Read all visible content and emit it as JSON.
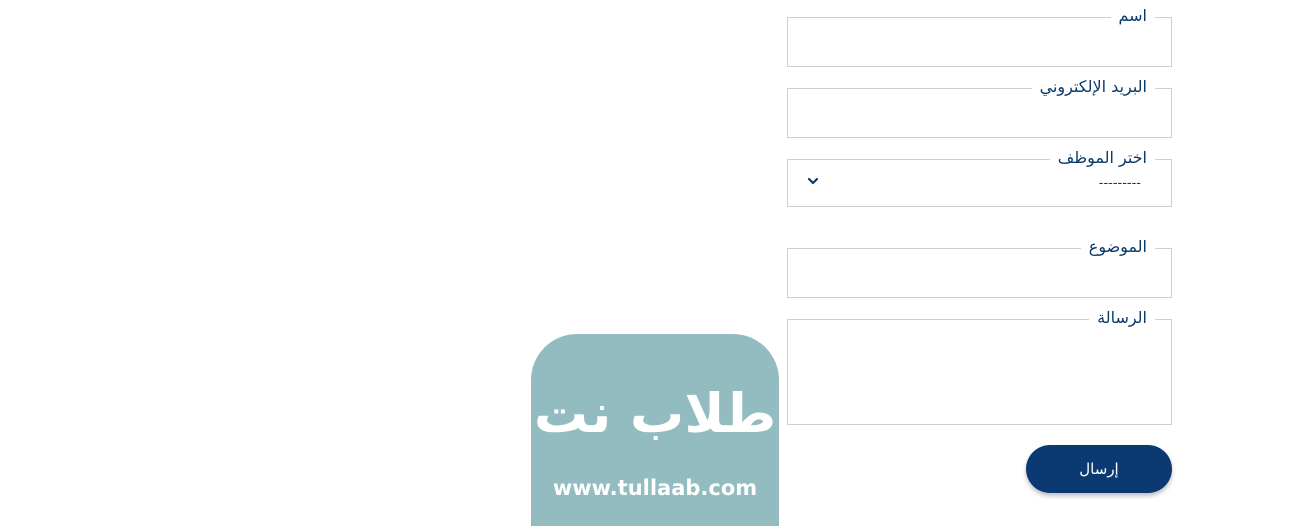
{
  "form": {
    "name_label": "اسم",
    "email_label": "البريد الإلكتروني",
    "employee_label": "اختر الموظف",
    "employee_selected": "---------",
    "subject_label": "الموضوع",
    "message_label": "الرسالة",
    "submit_label": "إرسال"
  },
  "logo": {
    "arabic_text": "طلاب نت",
    "url_text": "www.tullaab.com"
  },
  "colors": {
    "label": "#0b3a6b",
    "button": "#0b3a73",
    "border": "#cfcfcf",
    "logo_bg": "#92bcc0"
  }
}
